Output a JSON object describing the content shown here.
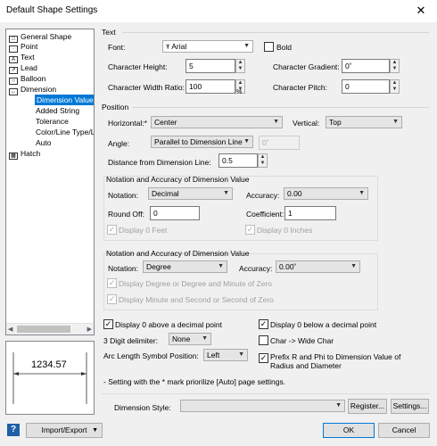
{
  "window": {
    "title": "Default Shape Settings",
    "close_glyph": "✕"
  },
  "tree": {
    "items": [
      {
        "label": "General Shape",
        "icon": "general-shape-icon"
      },
      {
        "label": "Point",
        "icon": "point-icon"
      },
      {
        "label": "Text",
        "icon": "text-icon"
      },
      {
        "label": "Lead",
        "icon": "lead-icon"
      },
      {
        "label": "Balloon",
        "icon": "balloon-icon"
      },
      {
        "label": "Dimension",
        "icon": "dimension-icon"
      },
      {
        "label": "Dimension Value",
        "selected": true
      },
      {
        "label": "Added String"
      },
      {
        "label": "Tolerance"
      },
      {
        "label": "Color/Line Type/L"
      },
      {
        "label": "Auto"
      },
      {
        "label": "Hatch",
        "icon": "hatch-icon"
      }
    ]
  },
  "preview": {
    "value": "1234.57"
  },
  "text": {
    "section": "Text",
    "font_label": "Font:",
    "font_value": "Arial",
    "bold_label": "Bold",
    "char_height_label": "Character Height:",
    "char_height_value": "5",
    "char_gradient_label": "Character Gradient:",
    "char_gradient_value": "0˚",
    "width_ratio_label": "Character Width Ratio:",
    "width_ratio_value": "100",
    "width_ratio_unit": "%",
    "pitch_label": "Character Pitch:",
    "pitch_value": "0"
  },
  "position": {
    "section": "Position",
    "horizontal_label": "Horizontal:*",
    "horizontal_value": "Center",
    "vertical_label": "Vertical:",
    "vertical_value": "Top",
    "angle_label": "Angle:",
    "angle_value": "Parallel to Dimension Line",
    "angle_deg": "0˚",
    "distance_label": "Distance from Dimension Line:",
    "distance_value": "0.5"
  },
  "notation1": {
    "title": "Notation and Accuracy of Dimension Value",
    "notation_label": "Notation:",
    "notation_value": "Decimal",
    "accuracy_label": "Accuracy:",
    "accuracy_value": "0.00",
    "roundoff_label": "Round Off:",
    "roundoff_value": "0",
    "coefficient_label": "Coefficient:",
    "coefficient_value": "1",
    "display_feet": "Display 0 Feet",
    "display_inches": "Display 0 Inches"
  },
  "notation2": {
    "title": "Notation and Accuracy of Dimension Value",
    "notation_label": "Notation:",
    "notation_value": "Degree",
    "accuracy_label": "Accuracy:",
    "accuracy_value": "0.00˚",
    "opt1": "Display Degree or Degree and Minute of Zero",
    "opt2": "Display Minute and Second or Second of Zero"
  },
  "misc": {
    "display_above": "Display 0 above a decimal point",
    "display_below": "Display 0 below a decimal point",
    "digit_delim_label": "3 Digit delimiter:",
    "digit_delim_value": "None",
    "char_wide": "Char -> Wide Char",
    "arc_label": "Arc Length Symbol Position:",
    "arc_value": "Left",
    "prefix": "Prefix R and Phi to Dimension Value of Radius and Diameter",
    "note": "- Setting with the * mark priorilize [Auto] page settings."
  },
  "footer": {
    "style_label": "Dimension Style:",
    "style_value": "",
    "register": "Register...",
    "settings": "Settings...",
    "import_export": "Import/Export",
    "ok": "OK",
    "cancel": "Cancel",
    "help_glyph": "?"
  }
}
